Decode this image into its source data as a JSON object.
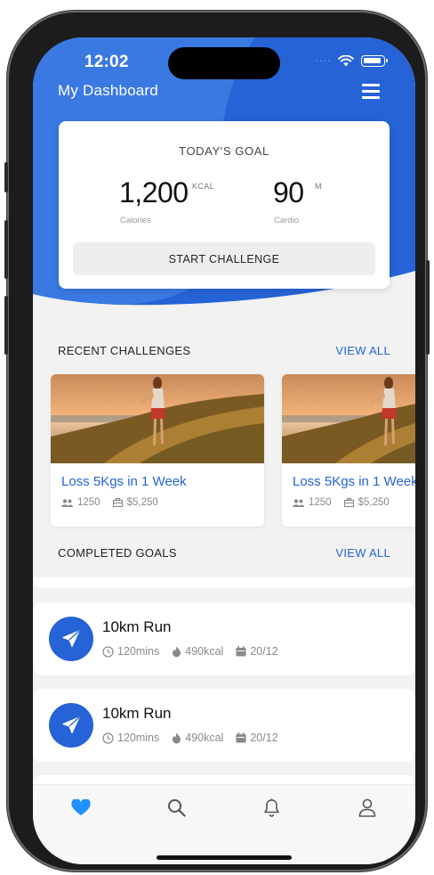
{
  "status_bar": {
    "time": "12:02",
    "dots": "····"
  },
  "header": {
    "title": "My Dashboard"
  },
  "goal_card": {
    "title": "TODAY'S GOAL",
    "calories": {
      "value": "1,200",
      "unit": "KCAL",
      "label": "Calories"
    },
    "cardio": {
      "value": "90",
      "unit": "M",
      "label": "Cardio"
    },
    "button_label": "START CHALLENGE"
  },
  "recent_challenges": {
    "title": "RECENT CHALLENGES",
    "view_all": "VIEW ALL",
    "items": [
      {
        "name": "Loss 5Kgs in 1 Week",
        "participants": "1250",
        "prize": "$5,250"
      },
      {
        "name": "Loss 5Kgs in 1 Week",
        "participants": "1250",
        "prize": "$5,250"
      }
    ]
  },
  "completed_goals": {
    "title": "COMPLETED GOALS",
    "view_all": "VIEW ALL",
    "items": [
      {
        "name": "10km Run",
        "duration": "120mins",
        "calories": "490kcal",
        "date": "20/12"
      },
      {
        "name": "10km Run",
        "duration": "120mins",
        "calories": "490kcal",
        "date": "20/12"
      }
    ]
  },
  "tabbar": {
    "tabs": [
      {
        "icon": "heart-icon",
        "active": true
      },
      {
        "icon": "search-icon",
        "active": false
      },
      {
        "icon": "bell-icon",
        "active": false
      },
      {
        "icon": "user-icon",
        "active": false
      }
    ]
  },
  "colors": {
    "primary": "#2563d6",
    "active_tab": "#1e90ff",
    "background": "#f2f2f2"
  }
}
